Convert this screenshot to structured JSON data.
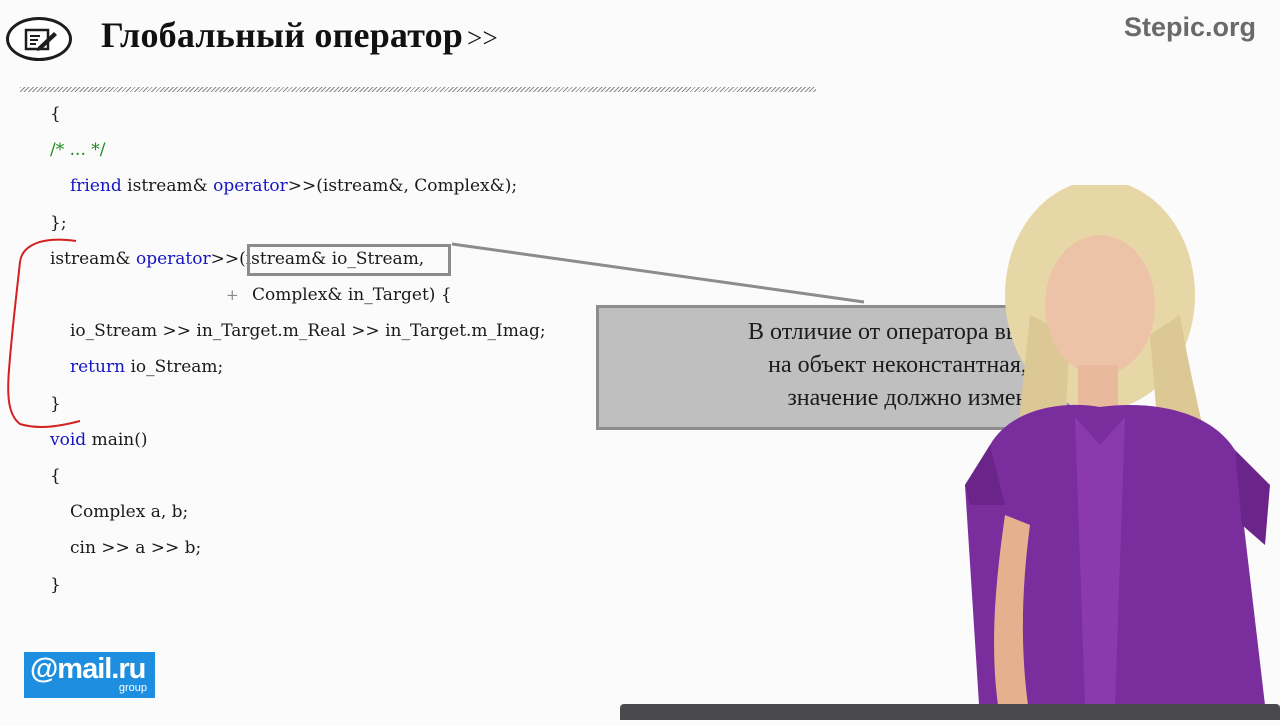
{
  "header": {
    "icon": "notepad-pencil-icon",
    "title": "Глобальный оператор",
    "title_operator": ">>",
    "brand": "Stepic.org"
  },
  "code_lines": [
    [
      {
        "t": "{",
        "c": "p"
      }
    ],
    [
      {
        "t": "/* ... */",
        "c": "cm"
      }
    ],
    [
      {
        "t": "friend",
        "c": "kw"
      },
      {
        "t": " istream& ",
        "c": "p"
      },
      {
        "t": "operator",
        "c": "kw"
      },
      {
        "t": ">>(istream&, Complex&);",
        "c": "p"
      }
    ],
    [
      {
        "t": "};",
        "c": "p"
      }
    ],
    [
      {
        "t": "istream& ",
        "c": "p"
      },
      {
        "t": "operator",
        "c": "kw"
      },
      {
        "t": ">>(istream& io_Stream,",
        "c": "p"
      }
    ],
    [
      {
        "t": "Complex& in_Target) {",
        "c": "p"
      }
    ],
    [
      {
        "t": "io_Stream >> in_Target.m_Real >> in_Target.m_Imag;",
        "c": "p"
      }
    ],
    [
      {
        "t": "return",
        "c": "kw"
      },
      {
        "t": " io_Stream;",
        "c": "p"
      }
    ],
    [
      {
        "t": "}",
        "c": "p"
      }
    ],
    [
      {
        "t": "void",
        "c": "kw"
      },
      {
        "t": " main()",
        "c": "p"
      }
    ],
    [
      {
        "t": "{",
        "c": "p"
      }
    ],
    [
      {
        "t": "Complex a, b;",
        "c": "p"
      }
    ],
    [
      {
        "t": "cin >> a >> b;",
        "c": "p"
      }
    ],
    [
      {
        "t": "}",
        "c": "p"
      }
    ]
  ],
  "code_plus_glyph": "+",
  "callout": {
    "lines": [
      "В отличие от оператора вывода, со",
      "на объект неконстантная, т.к. е",
      "значение должно изменить"
    ]
  },
  "logo": {
    "main": "@mail.ru",
    "sub": "group"
  },
  "colors": {
    "keyword": "#1515c8",
    "comment": "#1b8a1b",
    "annotation": "#d42020",
    "logo_bg": "#1e8fe0"
  }
}
